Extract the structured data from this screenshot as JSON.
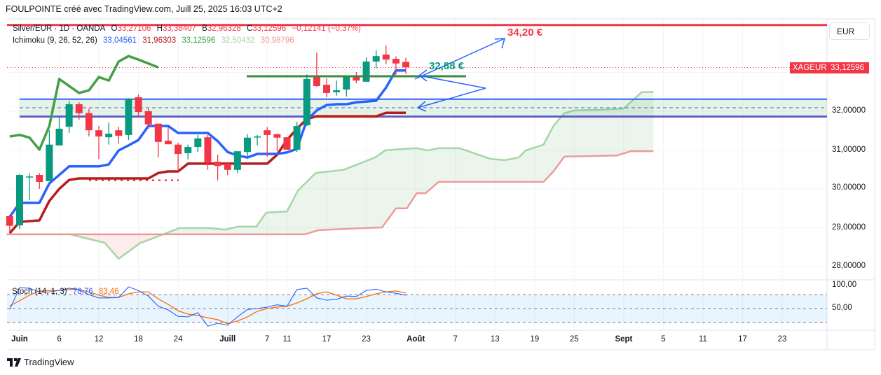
{
  "header": {
    "title": "FOULPOINTE créé avec TradingView.com, Juill 25, 2025 16:03 UTC+2"
  },
  "legend": {
    "symbol": "Silver/EUR · 1D · OANDA",
    "o_label": "O",
    "o": "33,27106",
    "h_label": "H",
    "h": "33,38407",
    "l_label": "B",
    "l": "32,96328",
    "c_label": "C",
    "c": "33,12596",
    "change": "−0,12141 (−0,37%)",
    "ichimoku_label": "Ichimoku (9, 26, 52, 26)",
    "ichimoku_values": [
      "33,04561",
      "31,96303",
      "33,12596",
      "32,50432",
      "30,98796"
    ],
    "stoch_label": "Stoch (14, 1, 3)",
    "stoch_k": "78,76",
    "stoch_d": "83,46"
  },
  "price_axis": {
    "currency_button": "EUR",
    "labels": [
      "32,00000",
      "31,00000",
      "30,00000",
      "29,00000",
      "28,00000"
    ],
    "symbol_tag": "XAGEUR",
    "last_price": "33,12596",
    "stoch_labels": [
      "100,00",
      "50,00"
    ]
  },
  "time_axis": {
    "labels": [
      "Juin",
      "6",
      "12",
      "18",
      "24",
      "Juill",
      "7",
      "11",
      "17",
      "23",
      "Août",
      "7",
      "13",
      "19",
      "25",
      "Sept",
      "5",
      "11",
      "17",
      "23"
    ],
    "bar_index": [
      0,
      4,
      8,
      12,
      16,
      21,
      25,
      27,
      31,
      35,
      40,
      44,
      48,
      52,
      56,
      61,
      65,
      69,
      73,
      77
    ]
  },
  "annotations": {
    "target_high": "34,20 €",
    "support_level": "32,88 €"
  },
  "branding": {
    "logo_text": "TradingView"
  },
  "colors": {
    "up": "#089981",
    "down": "#f23645",
    "tenkan": "#2962ff",
    "kijun": "#b71c1c",
    "chikou": "#43a047",
    "spanA": "#a5d6a7",
    "spanB": "#ef9a9a",
    "stochK": "#2962ff",
    "stochD": "#ff6d00"
  },
  "chart_data": {
    "type": "candlestick",
    "title": "Silver/EUR · 1D · OANDA",
    "x_unit": "trading-day index (0 = Jun 2, 2025)",
    "ylim": [
      27.5,
      34.5
    ],
    "candles_start_index": -1,
    "candles": [
      [
        29.3,
        29.33,
        28.88,
        29.05
      ],
      [
        29.06,
        30.38,
        28.97,
        30.36
      ],
      [
        30.32,
        30.4,
        29.71,
        30.32
      ],
      [
        30.36,
        30.41,
        30.0,
        30.18
      ],
      [
        30.2,
        31.51,
        30.2,
        31.14
      ],
      [
        31.12,
        31.86,
        31.12,
        31.55
      ],
      [
        31.6,
        32.27,
        31.44,
        32.18
      ],
      [
        32.18,
        32.23,
        31.78,
        31.95
      ],
      [
        31.95,
        32.07,
        31.35,
        31.51
      ],
      [
        31.51,
        31.62,
        30.77,
        31.35
      ],
      [
        31.33,
        31.71,
        31.14,
        31.42
      ],
      [
        31.51,
        31.6,
        31.17,
        31.37
      ],
      [
        31.39,
        32.34,
        31.26,
        32.32
      ],
      [
        32.36,
        32.43,
        31.84,
        31.98
      ],
      [
        32.0,
        32.07,
        31.55,
        31.66
      ],
      [
        31.68,
        31.68,
        30.81,
        31.21
      ],
      [
        31.24,
        31.59,
        31.15,
        31.15
      ],
      [
        31.14,
        31.19,
        30.45,
        30.9
      ],
      [
        30.92,
        31.14,
        30.76,
        31.08
      ],
      [
        31.08,
        31.39,
        30.95,
        31.3
      ],
      [
        31.33,
        31.39,
        30.49,
        30.67
      ],
      [
        30.7,
        30.88,
        30.22,
        30.59
      ],
      [
        30.65,
        30.67,
        30.36,
        30.49
      ],
      [
        30.49,
        30.97,
        30.41,
        30.97
      ],
      [
        30.95,
        31.41,
        30.77,
        31.32
      ],
      [
        31.35,
        31.39,
        31.12,
        31.35
      ],
      [
        31.51,
        31.59,
        30.83,
        31.39
      ],
      [
        31.41,
        31.42,
        30.97,
        31.32
      ],
      [
        31.33,
        31.33,
        31.01,
        31.01
      ],
      [
        31.01,
        31.73,
        30.95,
        31.62
      ],
      [
        31.64,
        32.95,
        31.62,
        32.83
      ],
      [
        32.9,
        33.51,
        32.63,
        32.65
      ],
      [
        32.68,
        32.85,
        32.36,
        32.47
      ],
      [
        32.49,
        32.79,
        32.4,
        32.54
      ],
      [
        32.56,
        32.88,
        32.38,
        32.88
      ],
      [
        32.88,
        33.01,
        32.72,
        32.79
      ],
      [
        32.76,
        33.39,
        32.76,
        33.28
      ],
      [
        33.28,
        33.57,
        33.1,
        33.42
      ],
      [
        33.46,
        33.69,
        33.21,
        33.33
      ],
      [
        33.35,
        33.41,
        32.94,
        33.23
      ],
      [
        33.27,
        33.38,
        32.96,
        33.13
      ]
    ],
    "tenkan": [
      29.28,
      29.64,
      29.64,
      29.64,
      30.14,
      30.36,
      30.58,
      30.58,
      30.58,
      30.58,
      30.63,
      30.99,
      31.12,
      31.26,
      31.62,
      31.62,
      31.62,
      31.44,
      31.44,
      31.44,
      31.44,
      31.23,
      30.95,
      30.86,
      30.81,
      30.9,
      30.9,
      30.9,
      30.94,
      31.03,
      31.77,
      32.02,
      32.16,
      32.18,
      32.18,
      32.23,
      32.25,
      32.27,
      32.61,
      33.05,
      33.05
    ],
    "kijun": [
      28.86,
      29.15,
      29.17,
      29.19,
      29.69,
      30.0,
      30.23,
      30.27,
      30.27,
      30.27,
      30.27,
      30.27,
      30.27,
      30.27,
      30.27,
      30.41,
      30.45,
      30.45,
      30.65,
      30.65,
      30.65,
      30.65,
      30.65,
      30.65,
      30.65,
      30.65,
      30.65,
      30.88,
      31.26,
      31.55,
      31.8,
      31.87,
      31.87,
      31.87,
      31.87,
      31.87,
      31.87,
      31.87,
      31.96,
      31.96,
      31.96
    ],
    "chikou_offset": 25,
    "spanA": [
      [
        -1.3,
        28.83
      ],
      [
        5.1,
        28.83
      ],
      [
        8.6,
        28.61
      ],
      [
        10,
        28.2
      ],
      [
        12.2,
        28.61
      ],
      [
        13.6,
        28.74
      ],
      [
        16.1,
        28.99
      ],
      [
        19.2,
        28.99
      ],
      [
        20.7,
        28.95
      ],
      [
        22.1,
        29.03
      ],
      [
        23.9,
        29.03
      ],
      [
        24.9,
        29.39
      ],
      [
        27,
        29.42
      ],
      [
        28.1,
        29.96
      ],
      [
        29.9,
        30.41
      ],
      [
        32.7,
        30.49
      ],
      [
        34.1,
        30.63
      ],
      [
        35.9,
        30.81
      ],
      [
        36.9,
        30.99
      ],
      [
        38.7,
        31.03
      ],
      [
        40.1,
        31.05
      ],
      [
        41.2,
        30.99
      ],
      [
        42.3,
        31.05
      ],
      [
        44.4,
        31.05
      ],
      [
        46.1,
        30.9
      ],
      [
        47.6,
        30.77
      ],
      [
        49,
        30.74
      ],
      [
        50.4,
        30.81
      ],
      [
        51.1,
        30.99
      ],
      [
        52.9,
        31.14
      ],
      [
        53.9,
        31.62
      ],
      [
        55,
        31.95
      ],
      [
        56,
        32.02
      ],
      [
        58.9,
        32.04
      ],
      [
        61,
        32.07
      ],
      [
        62.8,
        32.49
      ],
      [
        64,
        32.5
      ]
    ],
    "spanB": [
      [
        -1.3,
        28.83
      ],
      [
        28.8,
        28.83
      ],
      [
        30.2,
        28.94
      ],
      [
        36.6,
        29.01
      ],
      [
        38,
        29.5
      ],
      [
        39.1,
        29.5
      ],
      [
        40.1,
        29.89
      ],
      [
        41,
        29.89
      ],
      [
        42.3,
        30.18
      ],
      [
        52.9,
        30.18
      ],
      [
        53.9,
        30.45
      ],
      [
        55,
        30.83
      ],
      [
        60.3,
        30.86
      ],
      [
        61.7,
        30.97
      ],
      [
        64,
        30.97
      ]
    ],
    "stoch_k": [
      48,
      95,
      94,
      86,
      86,
      89,
      94,
      91,
      80,
      73,
      73,
      74,
      97,
      89,
      77,
      55,
      47,
      33,
      32,
      41,
      12,
      18,
      14,
      32,
      48,
      50,
      53,
      58,
      55,
      91,
      94,
      73,
      68,
      70,
      77,
      76,
      89,
      92,
      86,
      83,
      78.76
    ],
    "stoch_d": [
      56,
      67,
      79,
      88,
      89,
      89,
      91,
      91,
      86,
      79,
      74,
      74,
      82,
      86,
      86,
      71,
      59,
      45,
      38,
      35,
      30,
      26,
      17,
      23,
      32,
      44,
      50,
      53,
      55,
      62,
      71,
      82,
      86,
      79,
      71,
      71,
      76,
      82,
      86,
      88,
      83.46
    ],
    "stoch_levels": [
      80,
      50,
      20
    ],
    "zone": {
      "top": 32.31,
      "mid": 32.09,
      "bottom": 31.87
    },
    "resistance_line": 34.22,
    "support_line": 32.9,
    "last_price_line": 33.126,
    "dotted_level": 30.22
  }
}
